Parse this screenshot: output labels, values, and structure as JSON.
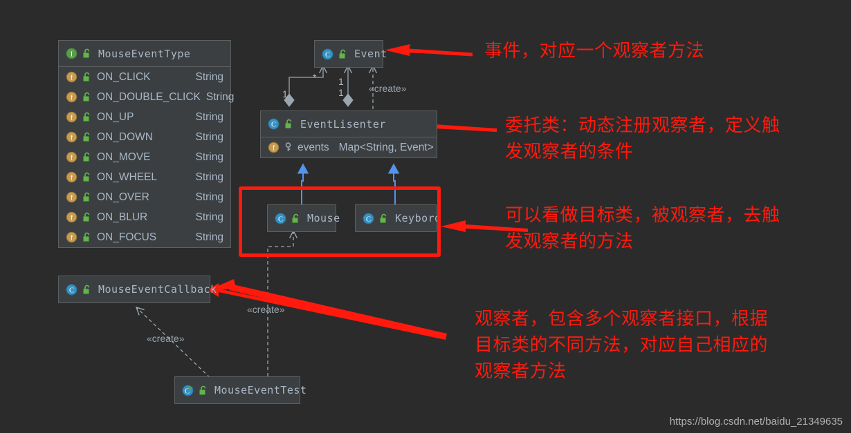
{
  "canvas": {
    "background": "#2b2b2b",
    "box_fill": "#3c3f41",
    "box_border": "#5e6060",
    "text_color": "#a9b7c6",
    "accent_red": "#ff1a0d",
    "accent_blue": "#5394ec",
    "line_gray": "#9aa7b0"
  },
  "classes": {
    "mouse_event_type": {
      "name": "MouseEventType",
      "icon": "interface-icon",
      "visibility_icon": "unlock-icon",
      "fields": [
        {
          "name": "ON_CLICK",
          "type": "String",
          "icon": "field-icon",
          "visibility_icon": "unlock-icon"
        },
        {
          "name": "ON_DOUBLE_CLICK",
          "type": "String",
          "icon": "field-icon",
          "visibility_icon": "unlock-icon"
        },
        {
          "name": "ON_UP",
          "type": "String",
          "icon": "field-icon",
          "visibility_icon": "unlock-icon"
        },
        {
          "name": "ON_DOWN",
          "type": "String",
          "icon": "field-icon",
          "visibility_icon": "unlock-icon"
        },
        {
          "name": "ON_MOVE",
          "type": "String",
          "icon": "field-icon",
          "visibility_icon": "unlock-icon"
        },
        {
          "name": "ON_WHEEL",
          "type": "String",
          "icon": "field-icon",
          "visibility_icon": "unlock-icon"
        },
        {
          "name": "ON_OVER",
          "type": "String",
          "icon": "field-icon",
          "visibility_icon": "unlock-icon"
        },
        {
          "name": "ON_BLUR",
          "type": "String",
          "icon": "field-icon",
          "visibility_icon": "unlock-icon"
        },
        {
          "name": "ON_FOCUS",
          "type": "String",
          "icon": "field-icon",
          "visibility_icon": "unlock-icon"
        }
      ]
    },
    "event": {
      "name": "Event",
      "icon": "class-icon",
      "visibility_icon": "unlock-icon"
    },
    "event_lisenter": {
      "name": "EventLisenter",
      "icon": "class-icon",
      "visibility_icon": "unlock-icon",
      "fields": [
        {
          "name": "events",
          "type": "Map<String, Event>",
          "icon": "field-icon",
          "visibility_icon": "private-key-icon"
        }
      ]
    },
    "mouse": {
      "name": "Mouse",
      "icon": "class-icon",
      "visibility_icon": "unlock-icon"
    },
    "keybord": {
      "name": "Keybord",
      "icon": "class-icon",
      "visibility_icon": "unlock-icon"
    },
    "mouse_event_callback": {
      "name": "MouseEventCallback",
      "icon": "class-icon",
      "visibility_icon": "unlock-icon"
    },
    "mouse_event_test": {
      "name": "MouseEventTest",
      "icon": "runnable-class-icon",
      "visibility_icon": "unlock-icon"
    }
  },
  "relationships": {
    "create_stereotype": "«create»",
    "labels": {
      "create_event_lisenter_to_event": "«create»",
      "create_test_to_callback": "«create»",
      "create_test_to_mouse": "«create»"
    },
    "multiplicities": {
      "star": "*",
      "one_left": "1",
      "one_mid_top": "1",
      "one_mid_bottom": "1"
    }
  },
  "annotations": [
    {
      "id": "anno-event",
      "text": "事件，对应一个观察者方法"
    },
    {
      "id": "anno-event-lisenter",
      "text": "委托类：动态注册观察者，定义触\n发观察者的条件"
    },
    {
      "id": "anno-target",
      "text": "可以看做目标类，被观察者，去触\n发观察者的方法"
    },
    {
      "id": "anno-observer",
      "text": "观察者，包含多个观察者接口，根据\n目标类的不同方法，对应自己相应的\n观察者方法"
    }
  ],
  "watermark": {
    "url": "https://blog.csdn.net/baidu_21349635"
  }
}
